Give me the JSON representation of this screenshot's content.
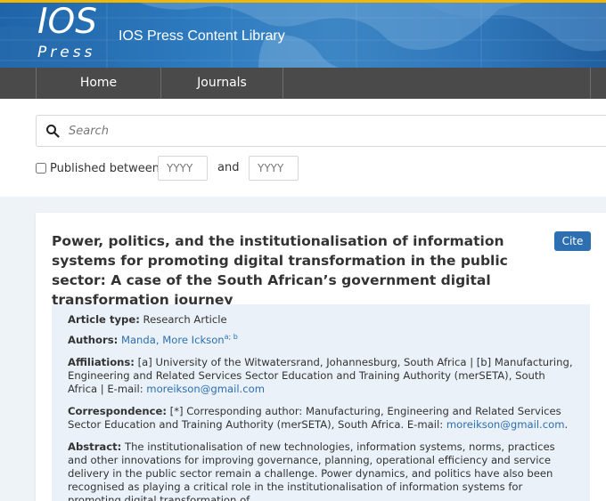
{
  "header": {
    "logo_top": "IOS",
    "logo_bottom": "Press",
    "site_title": "IOS Press Content Library",
    "accent_color": "#f2b705",
    "banner_color": "#2f7cc0"
  },
  "nav": {
    "items": [
      {
        "label": "Home"
      },
      {
        "label": "Journals"
      }
    ]
  },
  "search": {
    "placeholder": "Search",
    "icon": "search-icon"
  },
  "filter": {
    "published_between_label": "Published between:",
    "from_placeholder": "YYYY",
    "and_label": "and",
    "to_placeholder": "YYYY"
  },
  "article": {
    "title": "Power, politics, and the institutionalisation of information systems for promoting digital transformation in the public sector: A case of the South African’s government digital transformation journey",
    "cite_label": "Cite",
    "type_label": "Article type:",
    "type_value": "Research Article",
    "authors_label": "Authors:",
    "author_name": "Manda, More Ickson",
    "author_sup": "a; b",
    "affiliations_label": "Affiliations:",
    "affiliations_a_marker": "[a]",
    "affiliations_a_text": "University of the Witwatersrand, Johannesburg, South Africa |",
    "affiliations_b_marker": "[b]",
    "affiliations_b_text": "Manufacturing, Engineering and Related Services Sector Education and Training Authority (merSETA), South Africa | E-mail:",
    "affiliations_email": "moreikson@gmail.com",
    "correspondence_label": "Correspondence:",
    "correspondence_text": "[*] Corresponding author: Manufacturing, Engineering and Related Services Sector Education and Training Authority (merSETA), South Africa. E-mail:",
    "correspondence_email": "moreikson@gmail.com",
    "correspondence_end": ".",
    "abstract_label": "Abstract:",
    "abstract_text": "The institutionalisation of new technologies, information systems, norms, practices and other innovations for improving governance, planning, operational efficiency and service delivery in the public sector remain a challenge. Power dynamics, and politics have also been recognised as playing a critical role in the institutionalisation of information systems for promoting digital transformation of"
  }
}
